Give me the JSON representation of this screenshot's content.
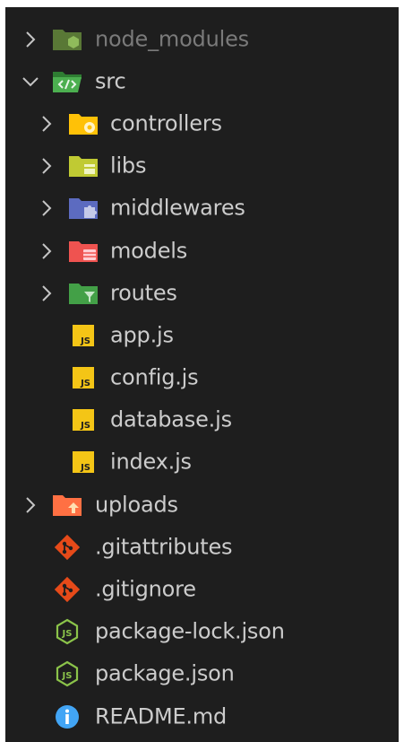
{
  "explorer": {
    "items": [
      {
        "label": "node_modules",
        "type": "folder",
        "state": "collapsed",
        "depth": 0,
        "icon": "folder-node-icon",
        "dimmed": true
      },
      {
        "label": "src",
        "type": "folder",
        "state": "expanded",
        "depth": 0,
        "icon": "folder-src-icon"
      },
      {
        "label": "controllers",
        "type": "folder",
        "state": "collapsed",
        "depth": 1,
        "icon": "folder-controllers-icon"
      },
      {
        "label": "libs",
        "type": "folder",
        "state": "collapsed",
        "depth": 1,
        "icon": "folder-libs-icon"
      },
      {
        "label": "middlewares",
        "type": "folder",
        "state": "collapsed",
        "depth": 1,
        "icon": "folder-middlewares-icon"
      },
      {
        "label": "models",
        "type": "folder",
        "state": "collapsed",
        "depth": 1,
        "icon": "folder-models-icon"
      },
      {
        "label": "routes",
        "type": "folder",
        "state": "collapsed",
        "depth": 1,
        "icon": "folder-routes-icon"
      },
      {
        "label": "app.js",
        "type": "file",
        "depth": 1,
        "icon": "javascript-file-icon"
      },
      {
        "label": "config.js",
        "type": "file",
        "depth": 1,
        "icon": "javascript-file-icon"
      },
      {
        "label": "database.js",
        "type": "file",
        "depth": 1,
        "icon": "javascript-file-icon"
      },
      {
        "label": "index.js",
        "type": "file",
        "depth": 1,
        "icon": "javascript-file-icon"
      },
      {
        "label": "uploads",
        "type": "folder",
        "state": "collapsed",
        "depth": 0,
        "icon": "folder-upload-icon"
      },
      {
        "label": ".gitattributes",
        "type": "file",
        "depth": 0,
        "icon": "git-icon"
      },
      {
        "label": ".gitignore",
        "type": "file",
        "depth": 0,
        "icon": "git-icon"
      },
      {
        "label": "package-lock.json",
        "type": "file",
        "depth": 0,
        "icon": "nodejs-icon"
      },
      {
        "label": "package.json",
        "type": "file",
        "depth": 0,
        "icon": "nodejs-icon"
      },
      {
        "label": "README.md",
        "type": "file",
        "depth": 0,
        "icon": "info-icon"
      }
    ]
  },
  "colors": {
    "background": "#1e1e1e",
    "text": "#cccccc",
    "dimmed_text": "#7a7a7a",
    "chevron": "#c5c5c5",
    "folder_node": "#8bc34a",
    "folder_src": "#4caf50",
    "folder_controllers": "#ffc107",
    "folder_libs": "#c0ca33",
    "folder_middlewares": "#7986cb",
    "folder_models": "#ef5350",
    "folder_routes": "#43a047",
    "javascript": "#f4c516",
    "folder_upload": "#ff7043",
    "git": "#e64a19",
    "nodejs": "#8bc34a",
    "info": "#42a5f5"
  }
}
